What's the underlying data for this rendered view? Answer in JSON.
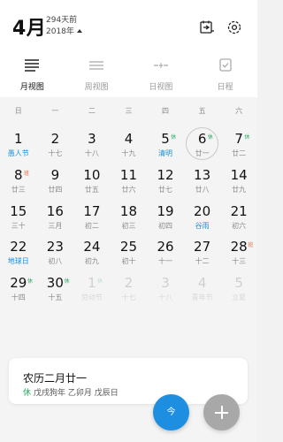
{
  "header": {
    "month": "4月",
    "days_ago": "294天前",
    "year": "2018年"
  },
  "tabs": [
    {
      "label": "月视图",
      "icon": "month-view-icon",
      "active": true
    },
    {
      "label": "周视图",
      "icon": "week-view-icon",
      "active": false
    },
    {
      "label": "日视图",
      "icon": "day-view-icon",
      "active": false
    },
    {
      "label": "日程",
      "icon": "schedule-icon",
      "active": false
    }
  ],
  "weekdays": [
    "日",
    "一",
    "二",
    "三",
    "四",
    "五",
    "六"
  ],
  "weeks": [
    [
      {
        "day": "1",
        "sub": "愚人节",
        "sub_color": "blue"
      },
      {
        "day": "2",
        "sub": "十七"
      },
      {
        "day": "3",
        "sub": "十八"
      },
      {
        "day": "4",
        "sub": "十九"
      },
      {
        "day": "5",
        "sub": "清明",
        "sub_color": "blue",
        "badge": "休",
        "badge_color": "green"
      },
      {
        "day": "6",
        "sub": "廿一",
        "badge": "休",
        "badge_color": "green",
        "today": true
      },
      {
        "day": "7",
        "sub": "廿二",
        "badge": "休",
        "badge_color": "green"
      }
    ],
    [
      {
        "day": "8",
        "sub": "廿三",
        "badge": "班",
        "badge_color": "red"
      },
      {
        "day": "9",
        "sub": "廿四"
      },
      {
        "day": "10",
        "sub": "廿五"
      },
      {
        "day": "11",
        "sub": "廿六"
      },
      {
        "day": "12",
        "sub": "廿七"
      },
      {
        "day": "13",
        "sub": "廿八"
      },
      {
        "day": "14",
        "sub": "廿九"
      }
    ],
    [
      {
        "day": "15",
        "sub": "三十"
      },
      {
        "day": "16",
        "sub": "三月"
      },
      {
        "day": "17",
        "sub": "初二"
      },
      {
        "day": "18",
        "sub": "初三"
      },
      {
        "day": "19",
        "sub": "初四"
      },
      {
        "day": "20",
        "sub": "谷雨",
        "sub_color": "blue"
      },
      {
        "day": "21",
        "sub": "初六"
      }
    ],
    [
      {
        "day": "22",
        "sub": "地球日",
        "sub_color": "blue"
      },
      {
        "day": "23",
        "sub": "初八"
      },
      {
        "day": "24",
        "sub": "初九"
      },
      {
        "day": "25",
        "sub": "初十"
      },
      {
        "day": "26",
        "sub": "十一"
      },
      {
        "day": "27",
        "sub": "十二"
      },
      {
        "day": "28",
        "sub": "十三",
        "badge": "班",
        "badge_color": "red"
      }
    ],
    [
      {
        "day": "29",
        "sub": "十四",
        "badge": "休",
        "badge_color": "green"
      },
      {
        "day": "30",
        "sub": "十五",
        "badge": "休",
        "badge_color": "green"
      },
      {
        "day": "1",
        "sub": "劳动节",
        "badge": "休",
        "badge_color": "green",
        "faded": true
      },
      {
        "day": "2",
        "sub": "十七",
        "faded": true
      },
      {
        "day": "3",
        "sub": "十八",
        "faded": true
      },
      {
        "day": "4",
        "sub": "青年节",
        "faded": true
      },
      {
        "day": "5",
        "sub": "立夏",
        "faded": true
      }
    ]
  ],
  "info_card": {
    "lunar_date": "农历二月廿一",
    "rest_tag": "休",
    "ganzhi": "戊戌狗年 乙卯月 戊辰日"
  },
  "fab": {
    "today_label": "今"
  },
  "colors": {
    "accent_blue": "#1e8fe0",
    "holiday_blue": "#1a8fd6",
    "rest_green": "#27a65a",
    "work_red": "#ea6a3a"
  }
}
